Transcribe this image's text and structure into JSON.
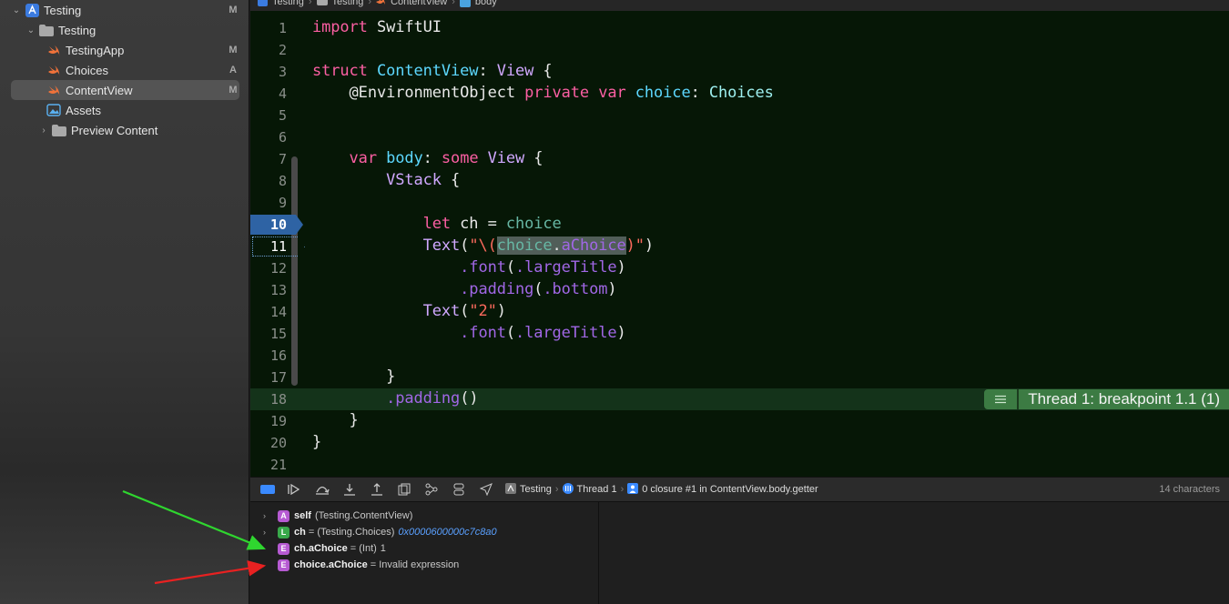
{
  "navigator": {
    "items": [
      {
        "label": "Testing",
        "badge": "M",
        "icon": "xcode-project-icon"
      },
      {
        "label": "Testing",
        "badge": "",
        "icon": "folder-icon"
      },
      {
        "label": "TestingApp",
        "badge": "M",
        "icon": "swift-file-icon"
      },
      {
        "label": "Choices",
        "badge": "A",
        "icon": "swift-file-icon"
      },
      {
        "label": "ContentView",
        "badge": "M",
        "icon": "swift-file-icon"
      },
      {
        "label": "Assets",
        "badge": "",
        "icon": "asset-catalog-icon"
      },
      {
        "label": "Preview Content",
        "badge": "",
        "icon": "folder-icon"
      }
    ]
  },
  "jumpbar": {
    "items": [
      "Testing",
      "Testing",
      "ContentView",
      "body"
    ]
  },
  "editor": {
    "line_numbers": [
      "1",
      "2",
      "3",
      "4",
      "5",
      "6",
      "7",
      "8",
      "9",
      "10",
      "11",
      "12",
      "13",
      "14",
      "15",
      "16",
      "17",
      "18",
      "19",
      "20",
      "21"
    ],
    "tokens": {
      "import": "import",
      "swiftui": "SwiftUI",
      "struct": "struct",
      "contentview": "ContentView",
      "colon": ":",
      "view": "View",
      "brace_open": "{",
      "env_attr": "@EnvironmentObject",
      "private": "private",
      "var": "var",
      "choice": "choice",
      "choices": "Choices",
      "body": "body",
      "some": "some",
      "vstack": "VStack",
      "let": "let",
      "ch": "ch",
      "eq": "=",
      "text": "Text",
      "quote_open": "\"\\(",
      "choice_sel": "choice",
      "dot": ".",
      "achoice": "aChoice",
      "quote_close": ")\"",
      "paren_open": "(",
      "paren_close": ")",
      "font": ".font",
      "largetitle": ".largeTitle",
      "padding": ".padding",
      "bottom": ".bottom",
      "two": "\"2\"",
      "brace_close": "}",
      "padding_call": "()"
    },
    "breakpoint_line": "10",
    "current_line": "11",
    "highlight_line": "18",
    "thread_label": "Thread 1: breakpoint 1.1 (1)"
  },
  "debugbar": {
    "crumbs": [
      "Testing",
      "Thread 1",
      "0 closure #1 in ContentView.body.getter"
    ],
    "char_count": "14 characters"
  },
  "variables": [
    {
      "badge": "A",
      "color": "#b65ad2",
      "name": "self",
      "sep": "",
      "type": "(Testing.ContentView)",
      "value": "",
      "expandable": true
    },
    {
      "badge": "L",
      "color": "#38a94a",
      "name": "ch",
      "sep": " = ",
      "type": "(Testing.Choices)",
      "value": "0x0000600000c7c8a0",
      "expandable": true
    },
    {
      "badge": "E",
      "color": "#b65ad2",
      "name": "ch.aChoice",
      "sep": " = ",
      "type": "(Int)",
      "value": "1",
      "expandable": false
    },
    {
      "badge": "E",
      "color": "#b65ad2",
      "name": "choice.aChoice",
      "sep": " = ",
      "type": "",
      "value": "Invalid expression",
      "expandable": false
    }
  ],
  "colors": {
    "editor_bg": "#061706",
    "keyword": "#fc5fa3",
    "type": "#d0a8ff",
    "breakpoint": "#2e63a4",
    "thread_badge": "#3c7b43",
    "green_arrow": "#2fd62f",
    "red_arrow": "#e82121"
  }
}
